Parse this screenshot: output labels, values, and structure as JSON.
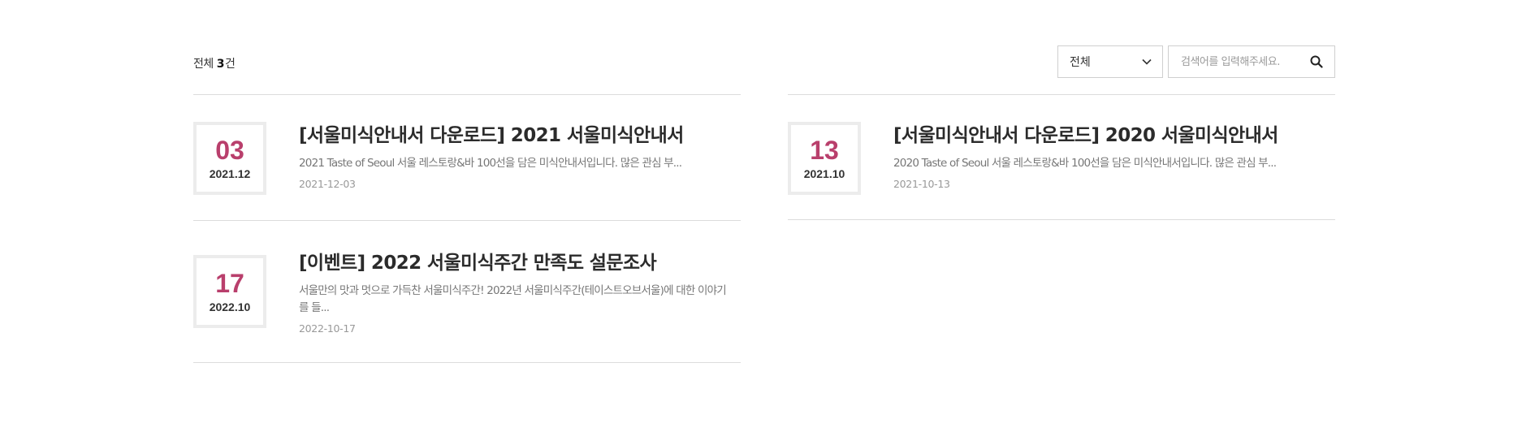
{
  "summary": {
    "prefix": "전체",
    "count": "3",
    "suffix": "건"
  },
  "filter": {
    "selected": "전체",
    "options": [
      "전체"
    ]
  },
  "search": {
    "placeholder": "검색어를 입력해주세요.",
    "value": ""
  },
  "icons": {
    "dropdown": "chevron-down-icon",
    "search": "search-icon"
  },
  "colors": {
    "accent": "#b93f6c",
    "border": "#dcdcdc"
  },
  "posts": [
    {
      "day": "03",
      "yearMonth": "2021.12",
      "title": "[서울미식안내서 다운로드] 2021 서울미식안내서",
      "description": "2021 Taste of Seoul 서울 레스토랑&바 100선을 담은 미식안내서입니다. 많은 관심 부...",
      "date": "2021-12-03"
    },
    {
      "day": "13",
      "yearMonth": "2021.10",
      "title": "[서울미식안내서 다운로드] 2020 서울미식안내서",
      "description": "2020 Taste of Seoul 서울 레스토랑&바 100선을 담은 미식안내서입니다. 많은 관심 부...",
      "date": "2021-10-13"
    },
    {
      "day": "17",
      "yearMonth": "2022.10",
      "title": "[이벤트] 2022 서울미식주간 만족도 설문조사",
      "description": "서울만의 맛과 멋으로 가득찬 서울미식주간! 2022년 서울미식주간(테이스트오브서울)에 대한 이야기를 들...",
      "date": "2022-10-17"
    }
  ]
}
